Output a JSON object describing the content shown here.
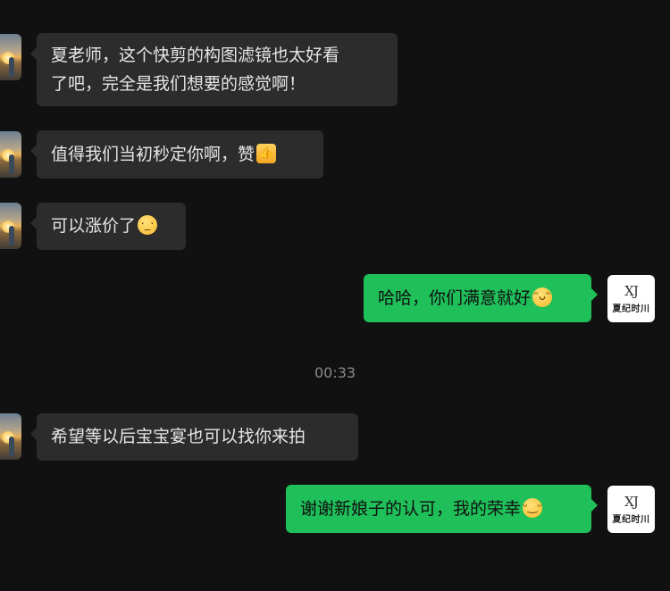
{
  "messages": [
    {
      "side": "in",
      "text": "夏老师，这个快剪的构图滤镜也太好看了吧，完全是我们想要的感觉啊！",
      "line1": "夏老师，这个快剪的构图滤镜也太好看",
      "line2": "了吧，完全是我们想要的感觉啊！"
    },
    {
      "side": "in",
      "text": "值得我们当初秒定你啊，赞",
      "emoji": "thumbs-up-emoji"
    },
    {
      "side": "in",
      "text": "可以涨价了",
      "emoji": "thinking-face-emoji"
    },
    {
      "side": "out",
      "text": "哈哈，你们满意就好",
      "emoji": "grinning-face-emoji"
    },
    {
      "side": "in",
      "text": "希望等以后宝宝宴也可以找你来拍"
    },
    {
      "side": "out",
      "text": "谢谢新娘子的认可，我的荣幸",
      "emoji": "smiling-face-emoji"
    }
  ],
  "timestamp": "00:33",
  "contact_avatar": {
    "logo_mark": "XJ",
    "logo_text": "夏纪时川"
  }
}
